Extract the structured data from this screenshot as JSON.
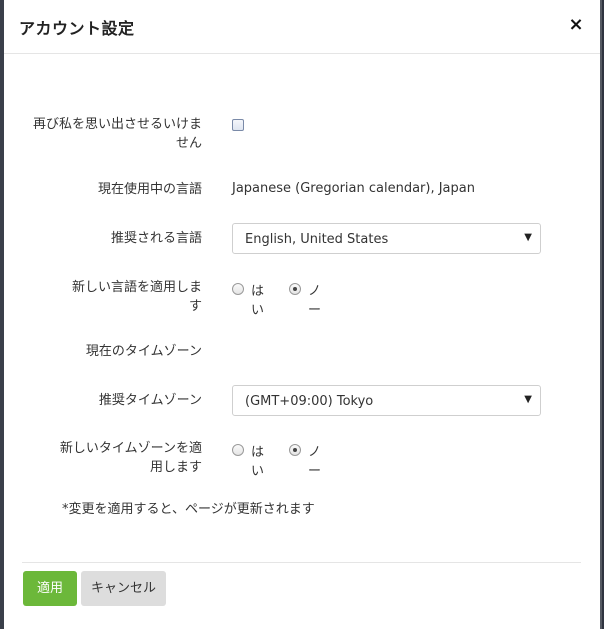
{
  "dialog": {
    "title": "アカウント設定",
    "close_glyph": "×"
  },
  "form": {
    "remember_me": {
      "label": "再び私を思い出させるいけません",
      "checked": false
    },
    "current_language": {
      "label": "現在使用中の言語",
      "value": "Japanese (Gregorian calendar), Japan"
    },
    "recommended_language": {
      "label": "推奨される言語",
      "selected": "English, United States",
      "arrow_icon": "caret-down-icon"
    },
    "apply_language": {
      "label": "新しい言語を適用します",
      "options": [
        {
          "label": "はい",
          "checked": false
        },
        {
          "label": "ノー",
          "checked": true
        }
      ]
    },
    "current_timezone": {
      "label": "現在のタイムゾーン",
      "value": ""
    },
    "recommended_timezone": {
      "label": "推奨タイムゾーン",
      "selected": "(GMT+09:00) Tokyo",
      "arrow_icon": "caret-down-icon"
    },
    "apply_timezone": {
      "label": "新しいタイムゾーンを適用します",
      "options": [
        {
          "label": "はい",
          "checked": false
        },
        {
          "label": "ノー",
          "checked": true
        }
      ]
    },
    "note": "*変更を適用すると、ページが更新されます"
  },
  "footer": {
    "apply_label": "適用",
    "cancel_label": "キャンセル"
  },
  "colors": {
    "apply_button": "#6cb83a",
    "cancel_button": "#dddddd",
    "backdrop": "#2f3440"
  }
}
